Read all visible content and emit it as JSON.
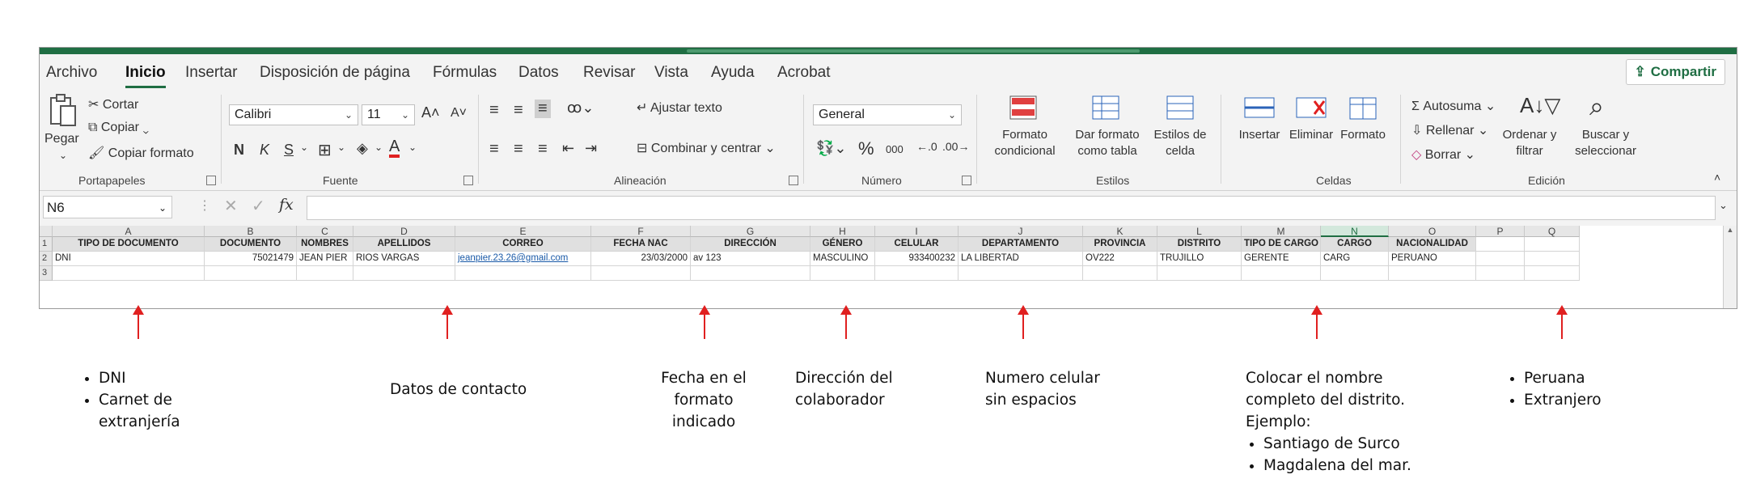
{
  "menu": {
    "tabs": [
      "Archivo",
      "Inicio",
      "Insertar",
      "Disposición de página",
      "Fórmulas",
      "Datos",
      "Revisar",
      "Vista",
      "Ayuda",
      "Acrobat"
    ],
    "active": "Inicio",
    "share_label": "Compartir"
  },
  "ribbon": {
    "clipboard": {
      "paste": "Pegar",
      "cut": "Cortar",
      "copy": "Copiar",
      "format_painter": "Copiar formato",
      "label": "Portapapeles"
    },
    "font": {
      "name": "Calibri",
      "size": "11",
      "bold": "N",
      "italic": "K",
      "underline": "S",
      "label": "Fuente"
    },
    "alignment": {
      "wrap": "Ajustar texto",
      "merge": "Combinar y centrar",
      "label": "Alineación"
    },
    "number": {
      "format": "General",
      "percent": "%",
      "thousands": "000",
      "label": "Número"
    },
    "styles": {
      "conditional": "Formato condicional",
      "table": "Dar formato como tabla",
      "cell": "Estilos de celda",
      "label": "Estilos"
    },
    "cells": {
      "insert": "Insertar",
      "delete": "Eliminar",
      "format": "Formato",
      "label": "Celdas"
    },
    "editing": {
      "autosum": "Autosuma",
      "fill": "Rellenar",
      "clear": "Borrar",
      "sort": "Ordenar y filtrar",
      "find": "Buscar y seleccionar",
      "label": "Edición"
    }
  },
  "formula_bar": {
    "name_box": "N6",
    "fx": "fx",
    "value": ""
  },
  "sheet": {
    "columns": [
      "A",
      "B",
      "C",
      "D",
      "E",
      "F",
      "G",
      "H",
      "I",
      "J",
      "K",
      "L",
      "M",
      "N",
      "O",
      "P",
      "Q"
    ],
    "selected_column": "N",
    "row_numbers": [
      "1",
      "2",
      "3"
    ],
    "headers": [
      "TIPO DE DOCUMENTO",
      "DOCUMENTO",
      "NOMBRES",
      "APELLIDOS",
      "CORREO",
      "FECHA NAC",
      "DIRECCIÓN",
      "GÉNERO",
      "CELULAR",
      "DEPARTAMENTO",
      "PROVINCIA",
      "DISTRITO",
      "TIPO DE CARGO",
      "CARGO",
      "NACIONALIDAD"
    ],
    "row2": [
      "DNI",
      "75021479",
      "JEAN PIER",
      "RIOS VARGAS",
      "jeanpier.23.26@gmail.com",
      "23/03/2000",
      "av 123",
      "MASCULINO",
      "933400232",
      "LA LIBERTAD",
      "OV222",
      "TRUJILLO",
      "GERENTE",
      "CARG",
      "PERUANO"
    ]
  },
  "annotations": {
    "tipo_documento": [
      "DNI",
      "Carnet de extranjería"
    ],
    "contacto": "Datos de contacto",
    "fecha": [
      "Fecha en el",
      "formato",
      "indicado"
    ],
    "direccion": [
      "Dirección del",
      "colaborador"
    ],
    "celular": [
      "Numero celular",
      "sin espacios"
    ],
    "distrito": {
      "lines": [
        "Colocar el nombre",
        "completo del distrito.",
        "Ejemplo:"
      ],
      "examples": [
        "Santiago de Surco",
        "Magdalena del mar."
      ]
    },
    "nacionalidad": [
      "Peruana",
      "Extranjero"
    ]
  },
  "colors": {
    "excel_green": "#1f6e43",
    "arrow_red": "#e02020",
    "link_blue": "#1a5aa8"
  }
}
